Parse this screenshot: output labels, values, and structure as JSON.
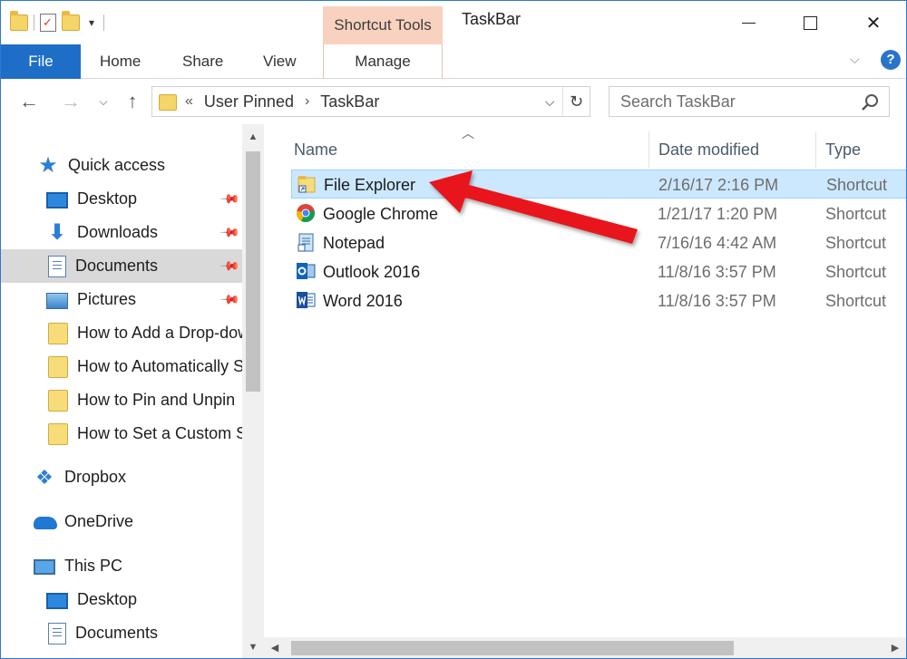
{
  "window": {
    "title": "TaskBar",
    "context_tab": "Shortcut Tools",
    "min_label": "Minimize",
    "max_label": "Maximize",
    "close_label": "Close"
  },
  "ribbon": {
    "file": "File",
    "home": "Home",
    "share": "Share",
    "view": "View",
    "manage": "Manage",
    "help": "?"
  },
  "address": {
    "overflow": "«",
    "crumbs": [
      "User Pinned",
      "TaskBar"
    ]
  },
  "search": {
    "placeholder": "Search TaskBar"
  },
  "navpane": {
    "items": [
      {
        "label": "Quick access",
        "icon": "star-icon"
      },
      {
        "label": "Desktop",
        "icon": "desktop-icon",
        "pinned": true
      },
      {
        "label": "Downloads",
        "icon": "downloads-icon",
        "pinned": true
      },
      {
        "label": "Documents",
        "icon": "documents-icon",
        "pinned": true,
        "selected": true
      },
      {
        "label": "Pictures",
        "icon": "pictures-icon",
        "pinned": true
      },
      {
        "label": "How to Add a Drop-dow",
        "icon": "folder-icon"
      },
      {
        "label": "How to Automatically S",
        "icon": "folder-icon"
      },
      {
        "label": "How to Pin and Unpin",
        "icon": "folder-icon"
      },
      {
        "label": "How to Set a Custom S",
        "icon": "folder-icon"
      },
      {
        "label": "Dropbox",
        "icon": "dropbox-icon"
      },
      {
        "label": "OneDrive",
        "icon": "onedrive-icon"
      },
      {
        "label": "This PC",
        "icon": "this-pc-icon"
      },
      {
        "label": "Desktop",
        "icon": "desktop-icon"
      },
      {
        "label": "Documents",
        "icon": "documents-icon"
      }
    ]
  },
  "columns": {
    "name": "Name",
    "date": "Date modified",
    "type": "Type"
  },
  "files": [
    {
      "name": "File Explorer",
      "date": "2/16/17 2:16 PM",
      "type": "Shortcut",
      "icon": "file-explorer-icon",
      "selected": true
    },
    {
      "name": "Google Chrome",
      "date": "1/21/17 1:20 PM",
      "type": "Shortcut",
      "icon": "chrome-icon"
    },
    {
      "name": "Notepad",
      "date": "7/16/16 4:42 AM",
      "type": "Shortcut",
      "icon": "notepad-icon"
    },
    {
      "name": "Outlook 2016",
      "date": "11/8/16 3:57 PM",
      "type": "Shortcut",
      "icon": "outlook-icon"
    },
    {
      "name": "Word 2016",
      "date": "11/8/16 3:57 PM",
      "type": "Shortcut",
      "icon": "word-icon"
    }
  ],
  "colors": {
    "accent": "#1e6ec8",
    "context_tab": "#f8d1bf",
    "selection": "#cce8ff",
    "annotation_arrow": "#e8161b"
  }
}
